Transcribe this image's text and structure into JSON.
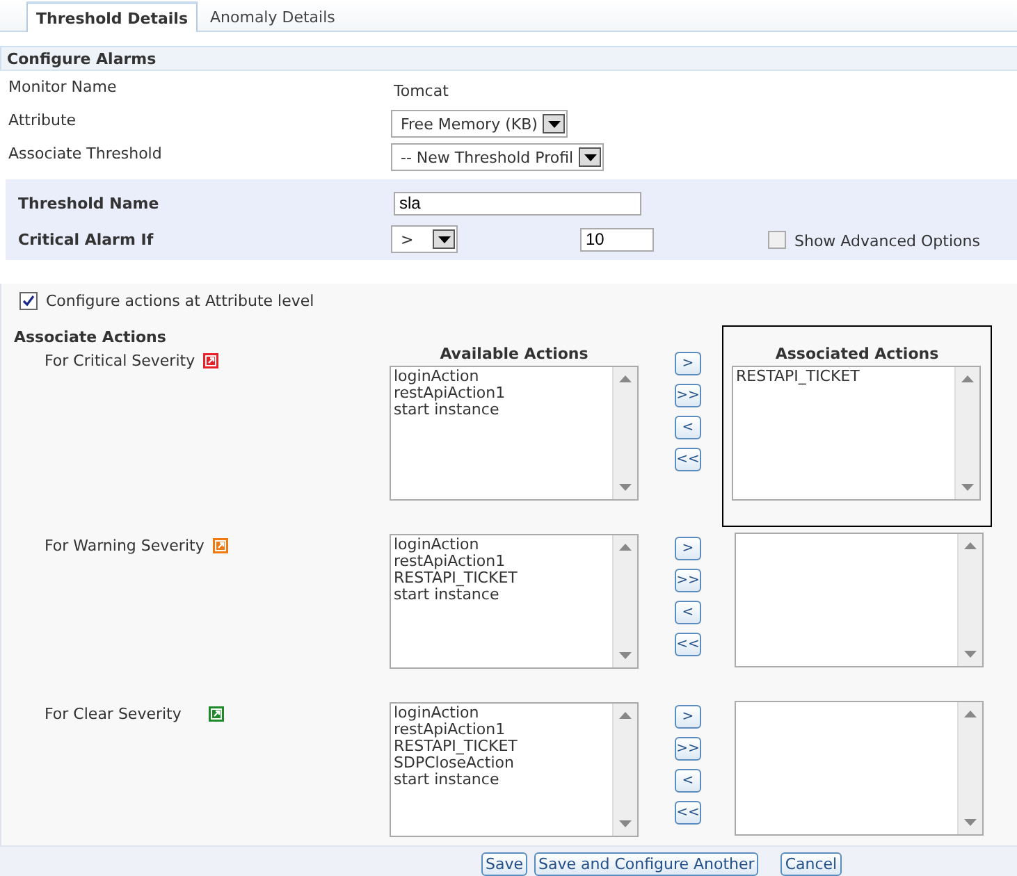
{
  "tabs": [
    {
      "label": "Threshold Details",
      "selected": true
    },
    {
      "label": "Anomaly Details",
      "selected": false
    }
  ],
  "section_title": "Configure Alarms",
  "fields": [
    {
      "kind": "text",
      "label": "Monitor Name",
      "value": "Tomcat"
    },
    {
      "kind": "select",
      "label": "Attribute",
      "value": "Free Memory (KB)"
    },
    {
      "kind": "select",
      "label": "Associate Threshold",
      "value": "-- New Threshold Profil"
    }
  ],
  "threshold": {
    "name_label": "Threshold Name",
    "name_value": "sla",
    "critical_label": "Critical Alarm If",
    "operator": ">",
    "critical_value": "10",
    "advanced_label": "Show Advanced Options",
    "advanced_checked": false
  },
  "attribute_level": {
    "label": "Configure actions at Attribute level",
    "checked": true
  },
  "actions_title": "Associate Actions",
  "severities": [
    {
      "label": "For Critical Severity",
      "color": "#e8202a",
      "highlighted": true,
      "available_heading": "Available Actions",
      "associated_heading": "Associated Actions",
      "available": [
        "loginAction",
        "restApiAction1",
        "start instance"
      ],
      "associated": [
        "RESTAPI_TICKET"
      ],
      "move_buttons": [
        ">",
        ">>",
        "<",
        "<<"
      ]
    },
    {
      "label": "For Warning Severity",
      "color": "#f07a10",
      "highlighted": false,
      "available": [
        "loginAction",
        "restApiAction1",
        "RESTAPI_TICKET",
        "start instance"
      ],
      "move_buttons": [
        ">",
        ">>",
        "<",
        "<<"
      ]
    },
    {
      "label": "For Clear Severity",
      "color": "#1f8a2a",
      "highlighted": false,
      "available": [
        "loginAction",
        "restApiAction1",
        "RESTAPI_TICKET",
        "SDPCloseAction",
        "start instance"
      ],
      "move_buttons": [
        ">",
        ">>",
        "<",
        "<<"
      ]
    }
  ],
  "buttons": [
    "Save",
    "Save and Configure Another",
    "Cancel"
  ]
}
